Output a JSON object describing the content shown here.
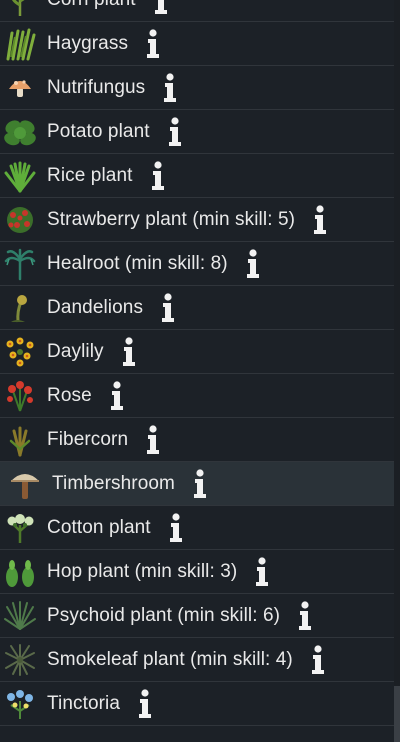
{
  "plants": [
    {
      "label": "Corn plant",
      "icon": "corn-plant-icon"
    },
    {
      "label": "Haygrass",
      "icon": "haygrass-icon"
    },
    {
      "label": "Nutrifungus",
      "icon": "nutrifungus-icon"
    },
    {
      "label": "Potato plant",
      "icon": "potato-plant-icon"
    },
    {
      "label": "Rice plant",
      "icon": "rice-plant-icon"
    },
    {
      "label": "Strawberry plant (min skill: 5)",
      "icon": "strawberry-plant-icon"
    },
    {
      "label": "Healroot (min skill: 8)",
      "icon": "healroot-icon"
    },
    {
      "label": "Dandelions",
      "icon": "dandelions-icon"
    },
    {
      "label": "Daylily",
      "icon": "daylily-icon"
    },
    {
      "label": "Rose",
      "icon": "rose-icon"
    },
    {
      "label": "Fibercorn",
      "icon": "fibercorn-icon"
    },
    {
      "label": "Timbershroom",
      "icon": "timbershroom-icon",
      "selected": true
    },
    {
      "label": "Cotton plant",
      "icon": "cotton-plant-icon"
    },
    {
      "label": "Hop plant (min skill: 3)",
      "icon": "hop-plant-icon"
    },
    {
      "label": "Psychoid plant (min skill: 6)",
      "icon": "psychoid-plant-icon"
    },
    {
      "label": "Smokeleaf plant (min skill: 4)",
      "icon": "smokeleaf-plant-icon"
    },
    {
      "label": "Tinctoria",
      "icon": "tinctoria-icon"
    }
  ],
  "info_icon": "info-icon",
  "colors": {
    "background": "#1c2127",
    "selected_row": "#2a3238",
    "divider": "#30353b",
    "text": "#e9e9e9",
    "info_icon": "#f2f2f2"
  }
}
